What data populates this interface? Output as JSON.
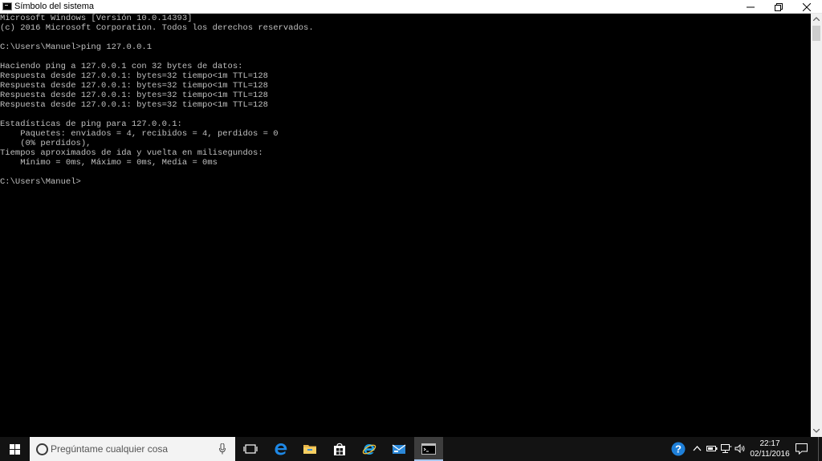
{
  "window": {
    "title": "Símbolo del sistema"
  },
  "console": {
    "lines": [
      "Microsoft Windows [Versión 10.0.14393]",
      "(c) 2016 Microsoft Corporation. Todos los derechos reservados.",
      "",
      "C:\\Users\\Manuel>ping 127.0.0.1",
      "",
      "Haciendo ping a 127.0.0.1 con 32 bytes de datos:",
      "Respuesta desde 127.0.0.1: bytes=32 tiempo<1m TTL=128",
      "Respuesta desde 127.0.0.1: bytes=32 tiempo<1m TTL=128",
      "Respuesta desde 127.0.0.1: bytes=32 tiempo<1m TTL=128",
      "Respuesta desde 127.0.0.1: bytes=32 tiempo<1m TTL=128",
      "",
      "Estadísticas de ping para 127.0.0.1:",
      "    Paquetes: enviados = 4, recibidos = 4, perdidos = 0",
      "    (0% perdidos),",
      "Tiempos aproximados de ida y vuelta en milisegundos:",
      "    Mínimo = 0ms, Máximo = 0ms, Media = 0ms",
      "",
      "C:\\Users\\Manuel>"
    ],
    "text_color": "#c0c0c0",
    "background": "#000000"
  },
  "taskbar": {
    "search_placeholder": "Pregúntame cualquier cosa",
    "pinned": [
      "start-icon",
      "task-view-icon",
      "edge-icon",
      "file-explorer-icon",
      "store-icon",
      "internet-explorer-icon",
      "mail-icon",
      "command-prompt-icon"
    ],
    "active_app": "command-prompt-icon"
  },
  "tray": {
    "time": "22:17",
    "date": "02/11/2016",
    "icons": [
      "help-icon",
      "chevron-up-icon",
      "battery-icon",
      "network-icon",
      "volume-icon",
      "notifications-icon"
    ]
  },
  "colors": {
    "taskbar": "#131313",
    "search_box": "#f3f3f3",
    "accent": "#a9c8f0"
  }
}
